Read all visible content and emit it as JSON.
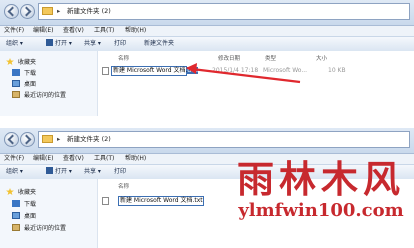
{
  "top": {
    "path": "新建文件夹 (2)",
    "menu": [
      "文件(F)",
      "编辑(E)",
      "查看(V)",
      "工具(T)",
      "帮助(H)"
    ],
    "toolbar": [
      "组织 ▾",
      "打开 ▾",
      "共享 ▾",
      "打印",
      "新建文件夹"
    ],
    "sidebar": [
      "收藏夹",
      "下载",
      "桌面",
      "最近访问的位置"
    ],
    "columns": [
      "名称",
      "修改日期",
      "类型",
      "大小"
    ],
    "file": {
      "name_before": "新建 Microsoft Word 文档.",
      "name_selected": "doc",
      "date": "2015/1/4 17:18",
      "type": "Microsoft Wo...",
      "size": "10 KB"
    }
  },
  "bottom": {
    "path": "新建文件夹 (2)",
    "menu": [
      "文件(F)",
      "编辑(E)",
      "查看(V)",
      "工具(T)",
      "帮助(H)"
    ],
    "toolbar": [
      "组织 ▾",
      "打开 ▾",
      "共享 ▾",
      "打印"
    ],
    "sidebar": [
      "收藏夹",
      "下载",
      "桌面",
      "最近访问的位置"
    ],
    "columns": [
      "名称"
    ],
    "file": {
      "name_before": "新建 Microsoft Word 文档.",
      "name_selected": "txt"
    }
  },
  "watermark": {
    "brand": "雨林木风",
    "url": "ylmfwin100.com"
  },
  "colors": {
    "arrow": "#e0282e",
    "selection": "#3c6fb3",
    "watermark": "#c7292e"
  }
}
